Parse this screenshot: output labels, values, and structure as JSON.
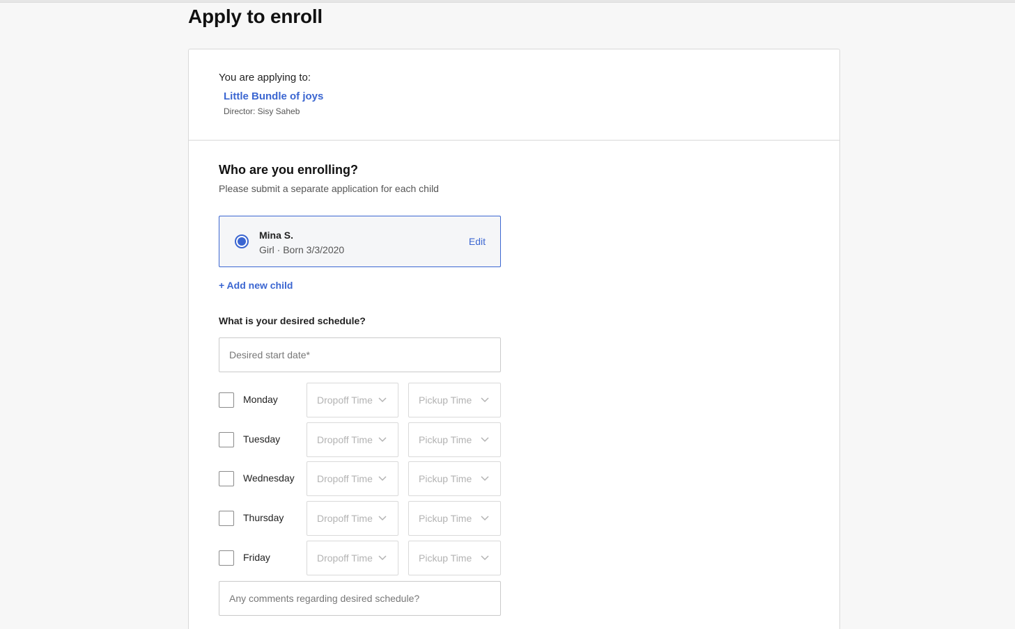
{
  "page": {
    "title": "Apply to enroll"
  },
  "provider": {
    "applying_label": "You are applying to:",
    "name": "Little Bundle of joys",
    "director": "Director: Sisy Saheb"
  },
  "enrollment": {
    "heading": "Who are you enrolling?",
    "subheading": "Please submit a separate application for each child",
    "child": {
      "name": "Mina S.",
      "meta": "Girl · Born 3/3/2020",
      "selected": true,
      "edit_label": "Edit"
    },
    "add_child_label": "+ Add new child"
  },
  "schedule": {
    "heading": "What is your desired schedule?",
    "start_date_placeholder": "Desired start date*",
    "start_date_value": "",
    "days": [
      {
        "label": "Monday",
        "checked": false,
        "dropoff": "Dropoff Time",
        "pickup": "Pickup Time"
      },
      {
        "label": "Tuesday",
        "checked": false,
        "dropoff": "Dropoff Time",
        "pickup": "Pickup Time"
      },
      {
        "label": "Wednesday",
        "checked": false,
        "dropoff": "Dropoff Time",
        "pickup": "Pickup Time"
      },
      {
        "label": "Thursday",
        "checked": false,
        "dropoff": "Dropoff Time",
        "pickup": "Pickup Time"
      },
      {
        "label": "Friday",
        "checked": false,
        "dropoff": "Dropoff Time",
        "pickup": "Pickup Time"
      }
    ],
    "comments_placeholder": "Any comments regarding desired schedule?",
    "comments_value": ""
  },
  "colors": {
    "accent": "#3b66d1",
    "background": "#f7f7f7",
    "border": "#d9d9d9",
    "placeholder_text": "#b3b3b3"
  },
  "icons": {
    "select_chevron": "chevron-down-icon"
  }
}
